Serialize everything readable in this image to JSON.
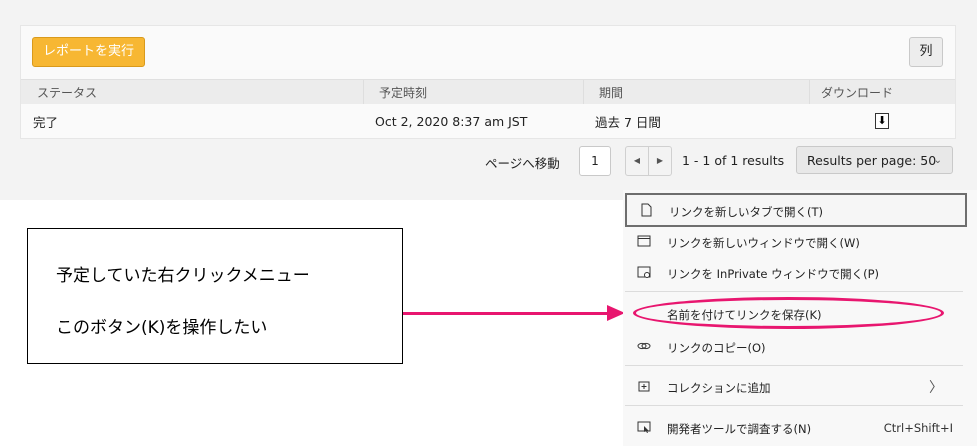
{
  "report": {
    "run_button": "レポートを実行",
    "columns_button": "列",
    "headers": [
      "ステータス",
      "予定時刻",
      "期間",
      "ダウンロード"
    ],
    "rows": [
      {
        "status": "完了",
        "scheduled": "Oct 2, 2020 8:37 am JST",
        "period": "過去 7 日間",
        "download": "⬇"
      }
    ]
  },
  "pagination": {
    "goto_label": "ページへ移動",
    "page": "1",
    "prev": "◀",
    "next": "▶",
    "range": "1 - 1 of 1 results",
    "per_page": "Results per page: 50",
    "chevron": "⌄"
  },
  "note": {
    "line1": "予定していた右クリックメニュー",
    "line2": "このボタン(K)を操作したい"
  },
  "context_menu": {
    "items": [
      {
        "label": "リンクを新しいタブで開く(T)",
        "icon": "new-tab-icon"
      },
      {
        "label": "リンクを新しいウィンドウで開く(W)",
        "icon": "new-window-icon"
      },
      {
        "label": "リンクを InPrivate ウィンドウで開く(P)",
        "icon": "inprivate-icon"
      },
      {
        "label": "名前を付けてリンクを保存(K)",
        "icon": ""
      },
      {
        "label": "リンクのコピー(O)",
        "icon": "link-icon"
      },
      {
        "label": "コレクションに追加",
        "icon": "collection-icon",
        "submenu_arrow": "〉"
      },
      {
        "label": "開発者ツールで調査する(N)",
        "icon": "devtools-icon",
        "shortcut": "Ctrl+Shift+I"
      }
    ]
  },
  "colors": {
    "accent": "#f7b733",
    "annotation": "#e8166f"
  }
}
